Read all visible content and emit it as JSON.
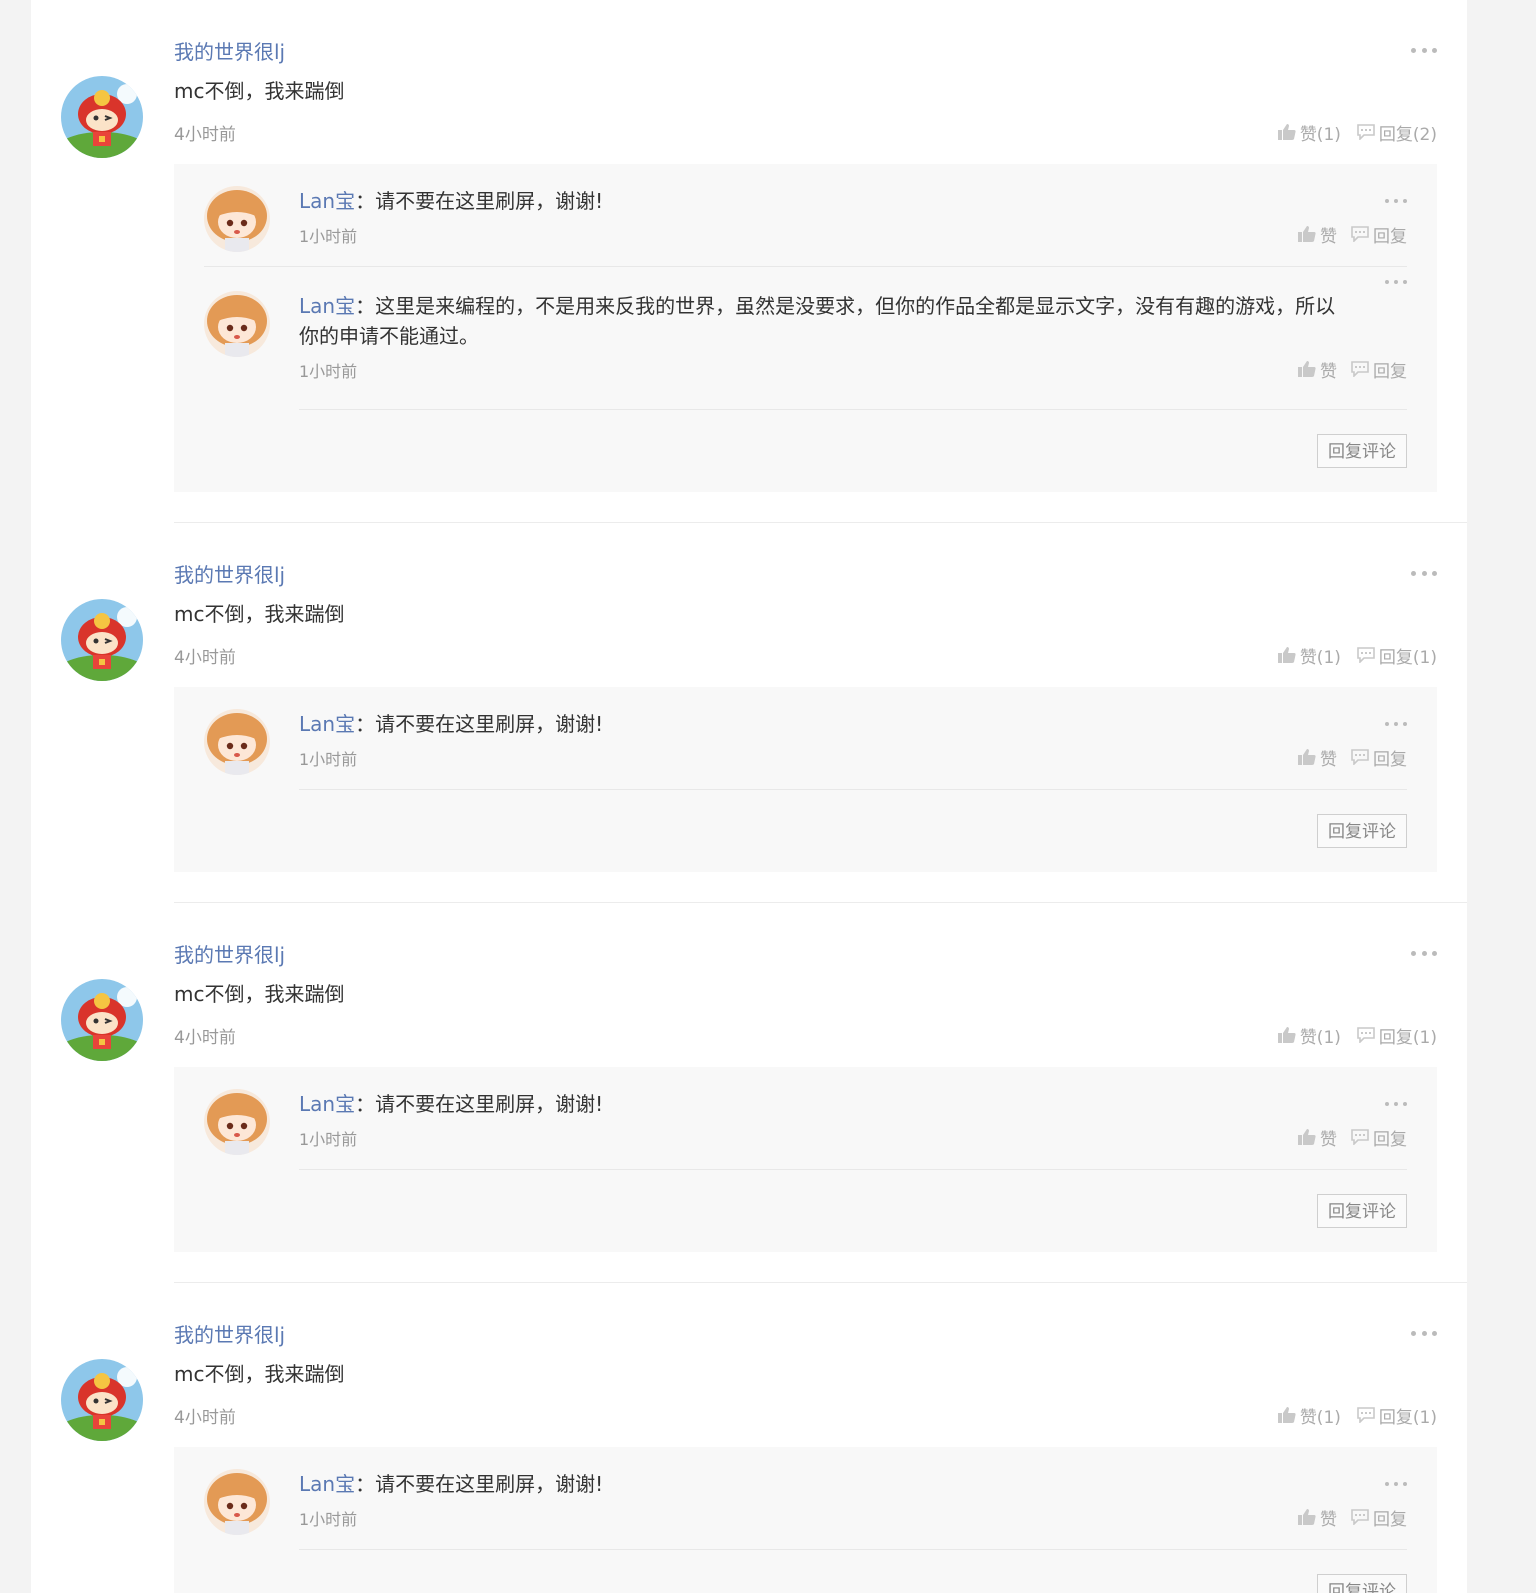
{
  "comments": [
    {
      "author": "我的世界很lj",
      "text": "mc不倒，我来踹倒",
      "time": "4小时前",
      "like_label": "赞(1)",
      "reply_label": "回复(2)",
      "replies": [
        {
          "author": "Lan宝",
          "sep": "：",
          "text": "请不要在这里刷屏，谢谢!",
          "time": "1小时前",
          "like_label": "赞",
          "reply_label": "回复"
        },
        {
          "author": "Lan宝",
          "sep": "：",
          "text": "这里是来编程的，不是用来反我的世界，虽然是没要求，但你的作品全都是显示文字，没有有趣的游戏，所以你的申请不能通过。",
          "time": "1小时前",
          "like_label": "赞",
          "reply_label": "回复"
        }
      ],
      "reply_button": "回复评论"
    },
    {
      "author": "我的世界很lj",
      "text": "mc不倒，我来踹倒",
      "time": "4小时前",
      "like_label": "赞(1)",
      "reply_label": "回复(1)",
      "replies": [
        {
          "author": "Lan宝",
          "sep": "：",
          "text": "请不要在这里刷屏，谢谢!",
          "time": "1小时前",
          "like_label": "赞",
          "reply_label": "回复"
        }
      ],
      "reply_button": "回复评论"
    },
    {
      "author": "我的世界很lj",
      "text": "mc不倒，我来踹倒",
      "time": "4小时前",
      "like_label": "赞(1)",
      "reply_label": "回复(1)",
      "replies": [
        {
          "author": "Lan宝",
          "sep": "：",
          "text": "请不要在这里刷屏，谢谢!",
          "time": "1小时前",
          "like_label": "赞",
          "reply_label": "回复"
        }
      ],
      "reply_button": "回复评论"
    },
    {
      "author": "我的世界很lj",
      "text": "mc不倒，我来踹倒",
      "time": "4小时前",
      "like_label": "赞(1)",
      "reply_label": "回复(1)",
      "replies": [
        {
          "author": "Lan宝",
          "sep": "：",
          "text": "请不要在这里刷屏，谢谢!",
          "time": "1小时前",
          "like_label": "赞",
          "reply_label": "回复"
        }
      ],
      "reply_button": "回复评论"
    }
  ],
  "colors": {
    "name": "#5b79b3",
    "muted": "#999999",
    "reply_bg": "#f8f8f8"
  },
  "icons": {
    "like": "thumbs-up-icon",
    "reply": "speech-bubble-icon",
    "more": "more-dots-icon"
  }
}
